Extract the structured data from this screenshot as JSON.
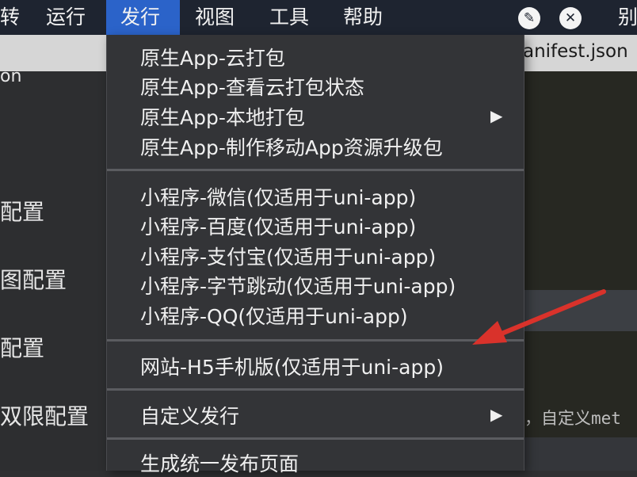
{
  "menubar": {
    "items": [
      "转",
      "运行",
      "发行",
      "视图",
      "工具",
      "帮助",
      "别"
    ],
    "active_index": 2,
    "tray_icons": [
      "feather-icon",
      "tools-icon"
    ]
  },
  "tab": {
    "label": "anifest.json"
  },
  "left_panel": {
    "title": "on",
    "items": [
      "配置",
      "图配置",
      "配置",
      "双限配置"
    ]
  },
  "editor": {
    "snippet": "，自定义met"
  },
  "dropdown": {
    "groups": [
      {
        "items": [
          {
            "label": "原生App-云打包",
            "submenu": false
          },
          {
            "label": "原生App-查看云打包状态",
            "submenu": false
          },
          {
            "label": "原生App-本地打包",
            "submenu": true
          },
          {
            "label": "原生App-制作移动App资源升级包",
            "submenu": false
          }
        ]
      },
      {
        "items": [
          {
            "label": "小程序-微信(仅适用于uni-app)",
            "submenu": false
          },
          {
            "label": "小程序-百度(仅适用于uni-app)",
            "submenu": false
          },
          {
            "label": "小程序-支付宝(仅适用于uni-app)",
            "submenu": false
          },
          {
            "label": "小程序-字节跳动(仅适用于uni-app)",
            "submenu": false
          },
          {
            "label": "小程序-QQ(仅适用于uni-app)",
            "submenu": false
          }
        ]
      },
      {
        "items": [
          {
            "label": "网站-H5手机版(仅适用于uni-app)",
            "submenu": false
          }
        ]
      },
      {
        "items": [
          {
            "label": "自定义发行",
            "submenu": true
          }
        ]
      },
      {
        "items": [
          {
            "label": "生成统一发布页面",
            "submenu": false
          }
        ]
      }
    ],
    "submenu_glyph": "▶"
  },
  "colors": {
    "menubar_bg": "#1e2430",
    "active_menu": "#2b63c9",
    "dropdown_bg": "#333437",
    "annotation_arrow": "#d9322b"
  }
}
